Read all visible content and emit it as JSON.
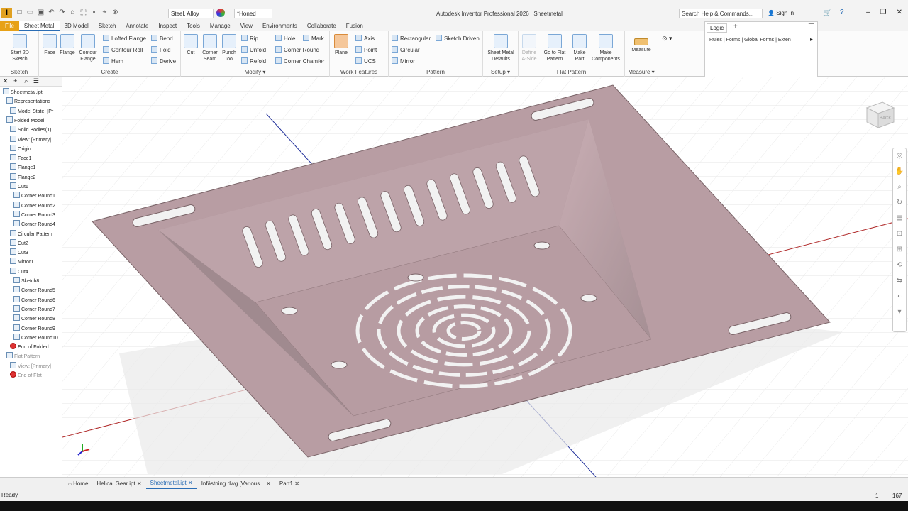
{
  "app": {
    "title": "Autodesk Inventor Professional 2026",
    "doc": "Sheetmetal",
    "logo": "I"
  },
  "qat": {
    "material": "Steel, Alloy",
    "appearance": "*Honed"
  },
  "search": {
    "placeholder": "Search Help & Commands..."
  },
  "user": {
    "signin": "Sign In"
  },
  "tabs": [
    "File",
    "Sheet Metal",
    "3D Model",
    "Sketch",
    "Annotate",
    "Inspect",
    "Tools",
    "Manage",
    "View",
    "Environments",
    "Collaborate",
    "Fusion"
  ],
  "ribbon": {
    "sketch": {
      "label": "Sketch",
      "start": "Start 2D Sketch"
    },
    "create": {
      "label": "Create",
      "face": "Face",
      "flange": "Flange",
      "contour_flange": "Contour Flange",
      "lofted_flange": "Lofted Flange",
      "contour_roll": "Contour Roll",
      "hem": "Hem",
      "bend": "Bend",
      "fold": "Fold",
      "derive": "Derive"
    },
    "modify": {
      "label": "Modify",
      "cut": "Cut",
      "corner_seam": "Corner Seam",
      "punch_tool": "Punch Tool",
      "rip": "Rip",
      "unfold": "Unfold",
      "refold": "Refold",
      "hole": "Hole",
      "mark": "Mark",
      "corner_round": "Corner Round",
      "corner_chamfer": "Corner Chamfer"
    },
    "work": {
      "label": "Work Features",
      "plane": "Plane",
      "axis": "Axis",
      "point": "Point",
      "ucs": "UCS"
    },
    "pattern": {
      "label": "Pattern",
      "rectangular": "Rectangular",
      "sketch_driven": "Sketch Driven",
      "circular": "Circular",
      "mirror": "Mirror"
    },
    "setup": {
      "label": "Setup",
      "defaults": "Sheet Metal Defaults"
    },
    "flat": {
      "label": "Flat Pattern",
      "define_aside": "Define A-Side",
      "goto": "Go to Flat Pattern",
      "make_part": "Make Part",
      "make_components": "Make Components"
    },
    "measure": {
      "label": "Measure",
      "measure": "Measure"
    }
  },
  "logic": {
    "tab": "Logic",
    "links": "Rules | Forms | Global Forms | Exten"
  },
  "browser": {
    "items": [
      "Sheetmetal.ipt",
      "Representations",
      "Model State: [Pr",
      "Folded Model",
      "Solid Bodies(1)",
      "View: [Primary]",
      "Origin",
      "Face1",
      "Flange1",
      "Flange2",
      "Cut1",
      "Corner Round1",
      "Corner Round2",
      "Corner Round3",
      "Corner Round4",
      "Circular Pattern",
      "Cut2",
      "Cut3",
      "Mirror1",
      "Cut4",
      "Sketch8",
      "Corner Round5",
      "Corner Round6",
      "Corner Round7",
      "Corner Round8",
      "Corner Round9",
      "Corner Round10",
      "End of Folded",
      "Flat Pattern",
      "View: [Primary]",
      "End of Flat"
    ]
  },
  "doc_tabs": [
    "Home",
    "Helical Gear.ipt",
    "Sheetmetal.ipt",
    "Infästning.dwg [Various...",
    "Part1"
  ],
  "status": {
    "text": "Ready",
    "num1": "1",
    "num2": "167"
  },
  "viewcube": {
    "label": "BACK"
  }
}
